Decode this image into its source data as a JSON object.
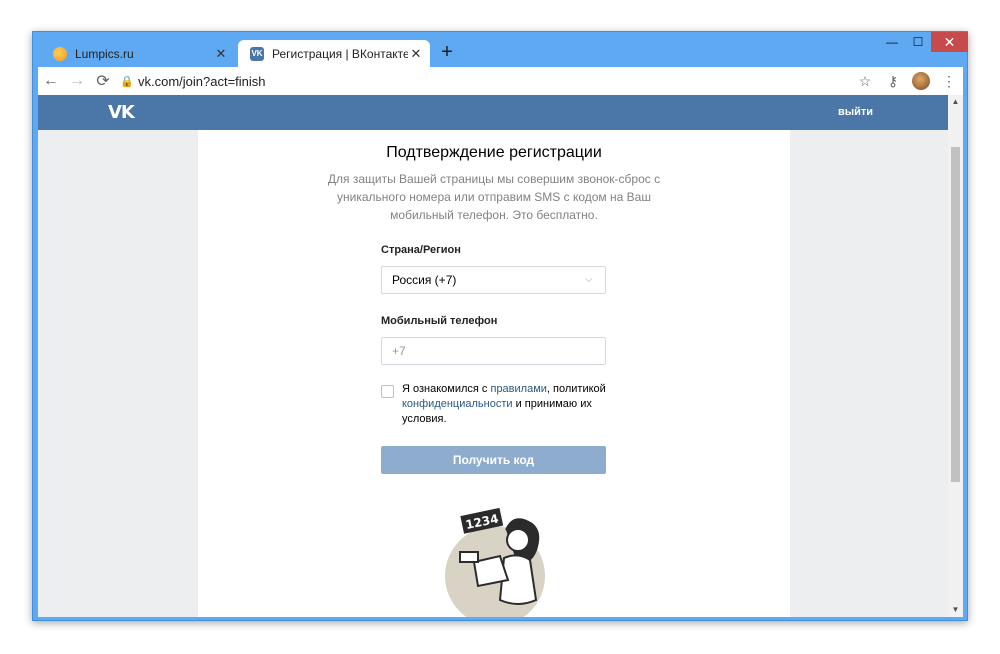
{
  "browser": {
    "tabs": [
      {
        "title": "Lumpics.ru",
        "favicon": "lumpics-favicon-icon",
        "close": "✕"
      },
      {
        "title": "Регистрация | ВКонтакте",
        "favicon": "vk-favicon-icon",
        "favicon_text": "VK",
        "close": "✕"
      }
    ],
    "new_tab": "+",
    "window_controls": {
      "minimize": "—",
      "maximize": "☐",
      "close": "✕"
    },
    "nav": {
      "back": "←",
      "forward": "→",
      "reload": "⟳"
    },
    "url": "vk.com/join?act=finish",
    "lock_icon": "🔒",
    "bookmark_icon": "☆",
    "key_icon": "⚷",
    "menu_icon": "⋮"
  },
  "vk": {
    "logo": "VK",
    "logout": "выйти",
    "brand_color": "#4a76a8"
  },
  "form": {
    "title": "Подтверждение регистрации",
    "description": "Для защиты Вашей страницы мы совершим звонок-сброс с уникального номера или отправим SMS с кодом на Ваш мобильный телефон. Это бесплатно.",
    "country_label": "Страна/Регион",
    "country_value": "Россия (+7)",
    "phone_label": "Мобильный телефон",
    "phone_placeholder": "+7",
    "terms": {
      "part1": "Я ознакомился с ",
      "link1": "правилами",
      "part2": ", политикой ",
      "link2": "конфиденциальности",
      "part3": " и принимаю их условия."
    },
    "submit": "Получить код"
  },
  "illustration": {
    "sign_text": "1234"
  }
}
